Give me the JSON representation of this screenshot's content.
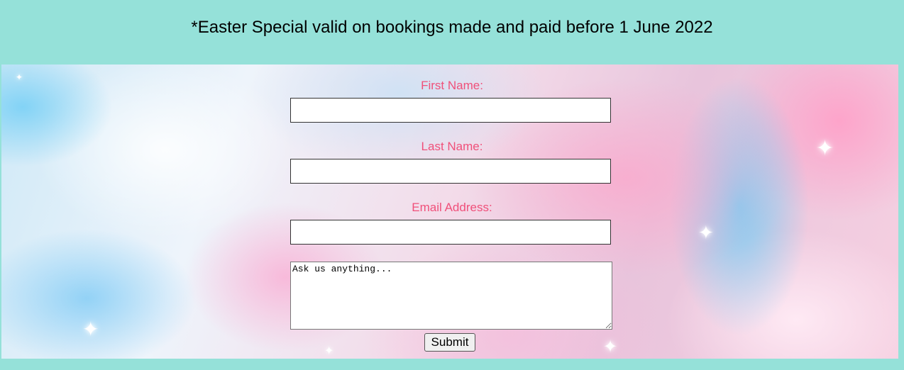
{
  "banner": {
    "text": "*Easter Special valid on bookings made and paid before 1 June 2022"
  },
  "form": {
    "first_name_label": "First Name:",
    "first_name_value": "",
    "last_name_label": "Last Name:",
    "last_name_value": "",
    "email_label": "Email Address:",
    "email_value": "",
    "message_placeholder": "Ask us anything...",
    "submit_label": "Submit"
  },
  "colors": {
    "page_background": "#95e1d9",
    "label_color": "#f0507a"
  }
}
